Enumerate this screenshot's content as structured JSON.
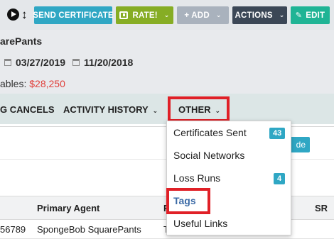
{
  "toolbar": {
    "send_certificate": "SEND CERTIFICATE",
    "rate": "RATE!",
    "add": "+ ADD",
    "actions": "ACTIONS",
    "edit": "EDIT",
    "caret": "⌄"
  },
  "header": {
    "name": "arePants",
    "date1": "03/27/2019",
    "date2": "11/20/2018",
    "receivables_label": "ables: ",
    "receivables_value": "$28,250"
  },
  "tabs": {
    "cancels": "G CANCELS",
    "activity_history": "ACTIVITY HISTORY",
    "other": "OTHER",
    "caret": "⌄"
  },
  "panel": {
    "ghost_button": "de"
  },
  "table": {
    "headers": [
      "Primary Agent",
      "P",
      "SR"
    ],
    "row": [
      "56789",
      "SpongeBob SquarePants",
      "T"
    ]
  },
  "dropdown": {
    "items": [
      {
        "label": "Certificates Sent",
        "badge": "43"
      },
      {
        "label": "Social Networks",
        "badge": ""
      },
      {
        "label": "Loss Runs",
        "badge": "4"
      },
      {
        "label": "Tags",
        "badge": ""
      },
      {
        "label": "Useful Links",
        "badge": ""
      }
    ]
  },
  "colors": {
    "highlight": "#e02027",
    "accent": "#2fa7c4",
    "amount": "#e0403b"
  }
}
